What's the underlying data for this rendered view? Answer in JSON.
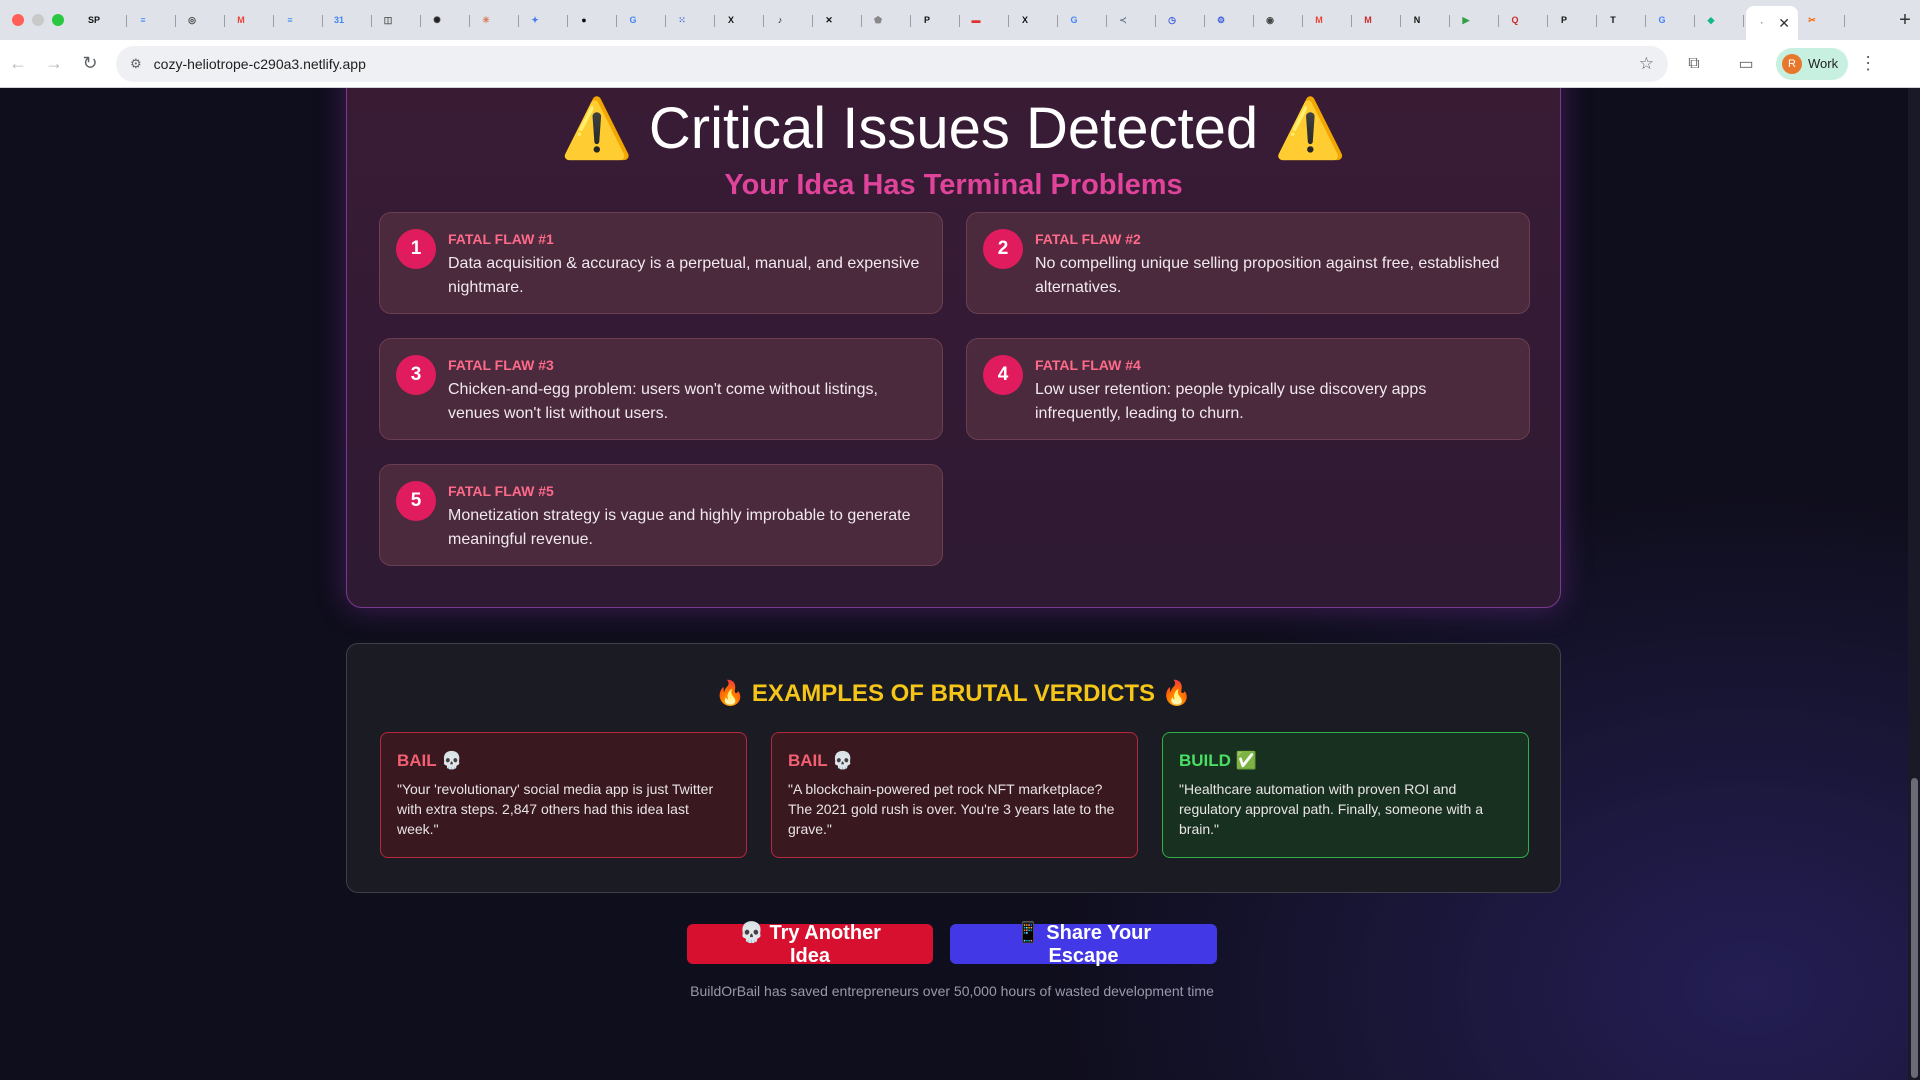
{
  "browser": {
    "tabs": [
      {
        "icon": "sp-icon",
        "glyph": "SP",
        "color": "#111111"
      },
      {
        "icon": "docs-icon",
        "glyph": "≡",
        "color": "#4285f4"
      },
      {
        "icon": "globe-icon",
        "glyph": "◎",
        "color": "#444444"
      },
      {
        "icon": "gmail-icon",
        "glyph": "M",
        "color": "#ea4335"
      },
      {
        "icon": "docs-icon",
        "glyph": "≡",
        "color": "#4285f4"
      },
      {
        "icon": "calendar-icon",
        "glyph": "31",
        "color": "#4285f4"
      },
      {
        "icon": "box-icon",
        "glyph": "◫",
        "color": "#555555"
      },
      {
        "icon": "openai-icon",
        "glyph": "✺",
        "color": "#222222"
      },
      {
        "icon": "claude-icon",
        "glyph": "✳",
        "color": "#d97757"
      },
      {
        "icon": "gemini-icon",
        "glyph": "✦",
        "color": "#4b7bec"
      },
      {
        "icon": "github-icon",
        "glyph": "●",
        "color": "#111111"
      },
      {
        "icon": "google-icon",
        "glyph": "G",
        "color": "#4285f4"
      },
      {
        "icon": "grid-icon",
        "glyph": "⁙",
        "color": "#3b5bdb"
      },
      {
        "icon": "x-icon",
        "glyph": "X",
        "color": "#111111"
      },
      {
        "icon": "tiktok-icon",
        "glyph": "♪",
        "color": "#111111"
      },
      {
        "icon": "perplexity-icon",
        "glyph": "✕",
        "color": "#111111"
      },
      {
        "icon": "shape-icon",
        "glyph": "⬟",
        "color": "#888888"
      },
      {
        "icon": "p-icon",
        "glyph": "P",
        "color": "#111111"
      },
      {
        "icon": "red-icon",
        "glyph": "▬",
        "color": "#e03131"
      },
      {
        "icon": "x-icon",
        "glyph": "X",
        "color": "#111111"
      },
      {
        "icon": "google-icon",
        "glyph": "G",
        "color": "#4285f4"
      },
      {
        "icon": "share-icon",
        "glyph": "≺",
        "color": "#6c7a89"
      },
      {
        "icon": "history-icon",
        "glyph": "◷",
        "color": "#3b5bdb"
      },
      {
        "icon": "gear-icon",
        "glyph": "⚙",
        "color": "#3b5bdb"
      },
      {
        "icon": "chrome-icon",
        "glyph": "◉",
        "color": "#444444"
      },
      {
        "icon": "gmail-icon",
        "glyph": "M",
        "color": "#ea4335"
      },
      {
        "icon": "gmail-icon",
        "glyph": "M",
        "color": "#c92a2a"
      },
      {
        "icon": "notion-icon",
        "glyph": "N",
        "color": "#111111"
      },
      {
        "icon": "play-icon",
        "glyph": "▶",
        "color": "#2f9e44"
      },
      {
        "icon": "quora-icon",
        "glyph": "Q",
        "color": "#c92a2a"
      },
      {
        "icon": "p-icon",
        "glyph": "P",
        "color": "#111111"
      },
      {
        "icon": "nyt-icon",
        "glyph": "T",
        "color": "#111111"
      },
      {
        "icon": "google-icon",
        "glyph": "G",
        "color": "#4285f4"
      },
      {
        "icon": "diamond-icon",
        "glyph": "◆",
        "color": "#12b886"
      },
      {
        "icon": "active-tab-icon",
        "glyph": "·",
        "color": "#888888",
        "active": true
      },
      {
        "icon": "figma-icon",
        "glyph": "✂",
        "color": "#f76707"
      }
    ],
    "url": "cozy-heliotrope-c290a3.netlify.app",
    "profile_initial": "R",
    "profile_name": "Work"
  },
  "issues": {
    "title": "⚠️ Critical Issues Detected ⚠️",
    "subtitle": "Your Idea Has Terminal Problems",
    "flaws": [
      {
        "num": "1",
        "label": "FATAL FLAW #1",
        "desc": "Data acquisition & accuracy is a perpetual, manual, and expensive nightmare."
      },
      {
        "num": "2",
        "label": "FATAL FLAW #2",
        "desc": "No compelling unique selling proposition against free, established alternatives."
      },
      {
        "num": "3",
        "label": "FATAL FLAW #3",
        "desc": "Chicken-and-egg problem: users won't come without listings, venues won't list without users."
      },
      {
        "num": "4",
        "label": "FATAL FLAW #4",
        "desc": "Low user retention: people typically use discovery apps infrequently, leading to churn."
      },
      {
        "num": "5",
        "label": "FATAL FLAW #5",
        "desc": "Monetization strategy is vague and highly improbable to generate meaningful revenue."
      }
    ]
  },
  "examples": {
    "title": "🔥 EXAMPLES OF BRUTAL VERDICTS 🔥",
    "cards": [
      {
        "verdict": "BAIL 💀",
        "type": "bail",
        "quote": "\"Your 'revolutionary' social media app is just Twitter with extra steps. 2,847 others had this idea last week.\""
      },
      {
        "verdict": "BAIL 💀",
        "type": "bail",
        "quote": "\"A blockchain-powered pet rock NFT marketplace? The 2021 gold rush is over. You're 3 years late to the grave.\""
      },
      {
        "verdict": "BUILD ✅",
        "type": "build",
        "quote": "\"Healthcare automation with proven ROI and regulatory approval path. Finally, someone with a brain.\""
      }
    ]
  },
  "actions": {
    "try_label": "💀 Try Another Idea",
    "share_label": "📱 Share Your Escape"
  },
  "footer": {
    "note": "BuildOrBail has saved entrepreneurs over 50,000 hours of wasted development time"
  }
}
